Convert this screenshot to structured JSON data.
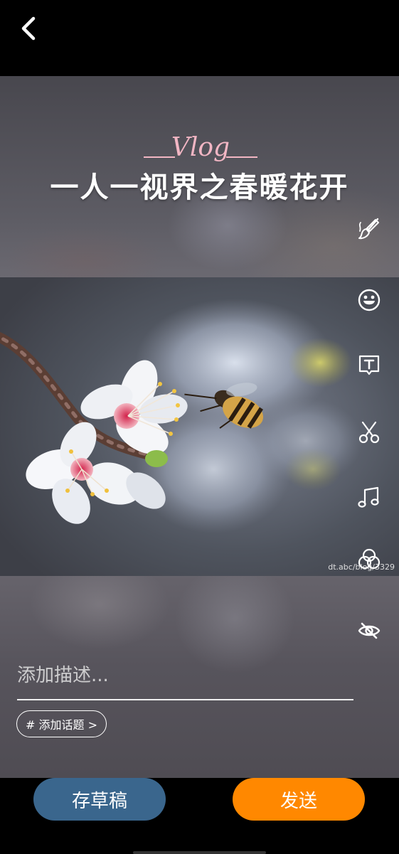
{
  "header": {
    "back_icon": "chevron-left-icon"
  },
  "cover": {
    "vlog_sticker_text": "Vlog",
    "title": "一人一视界之春暖花开",
    "watermark": "dt.abc/blog/3329"
  },
  "tools": [
    {
      "name": "brush-icon"
    },
    {
      "name": "emoji-icon"
    },
    {
      "name": "text-icon"
    },
    {
      "name": "scissors-icon"
    },
    {
      "name": "music-icon"
    },
    {
      "name": "filter-icon"
    },
    {
      "name": "eye-slash-icon"
    }
  ],
  "composer": {
    "description_placeholder": "添加描述...",
    "description_value": "",
    "topic_label": "# 添加话题 >"
  },
  "actions": {
    "draft_label": "存草稿",
    "send_label": "发送"
  },
  "colors": {
    "draft_button": "#3a668d",
    "send_button": "#ff8800",
    "vlog_sticker": "#f2b6c4"
  }
}
